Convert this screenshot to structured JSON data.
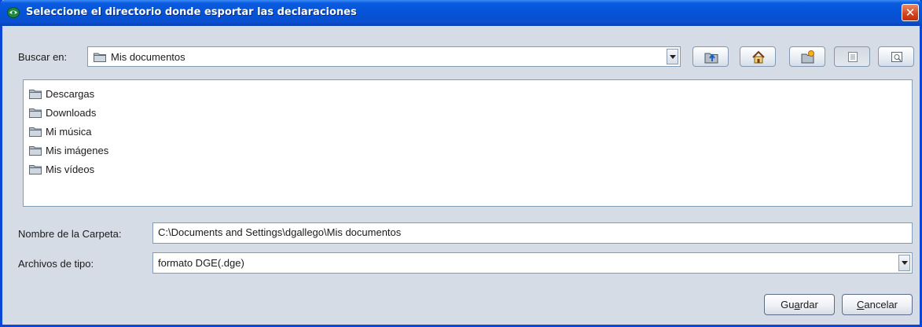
{
  "window": {
    "title": "Seleccione el directorio donde esportar las declaraciones",
    "close_glyph": "✕"
  },
  "lookin": {
    "label": "Buscar en:",
    "value": "Mis documentos"
  },
  "toolbar": {
    "icons": [
      "up-folder-icon",
      "home-icon",
      "new-folder-icon",
      "list-view-icon",
      "details-view-icon"
    ]
  },
  "files": [
    {
      "name": "Descargas"
    },
    {
      "name": "Downloads"
    },
    {
      "name": "Mi música"
    },
    {
      "name": "Mis imágenes"
    },
    {
      "name": "Mis vídeos"
    }
  ],
  "folder_name": {
    "label": "Nombre de la Carpeta:",
    "value": "C:\\Documents and Settings\\dgallego\\Mis documentos"
  },
  "file_type": {
    "label": "Archivos de tipo:",
    "value": "formato DGE(.dge)"
  },
  "buttons": {
    "save": {
      "before": "Gu",
      "mnemonic": "a",
      "after": "rdar"
    },
    "cancel": {
      "mnemonic": "C",
      "after": "ancelar"
    }
  },
  "colors": {
    "title_bar": "#0553d6",
    "close": "#d3431d",
    "window_bg": "#d6dce6",
    "folder": "#b5bfc9"
  }
}
